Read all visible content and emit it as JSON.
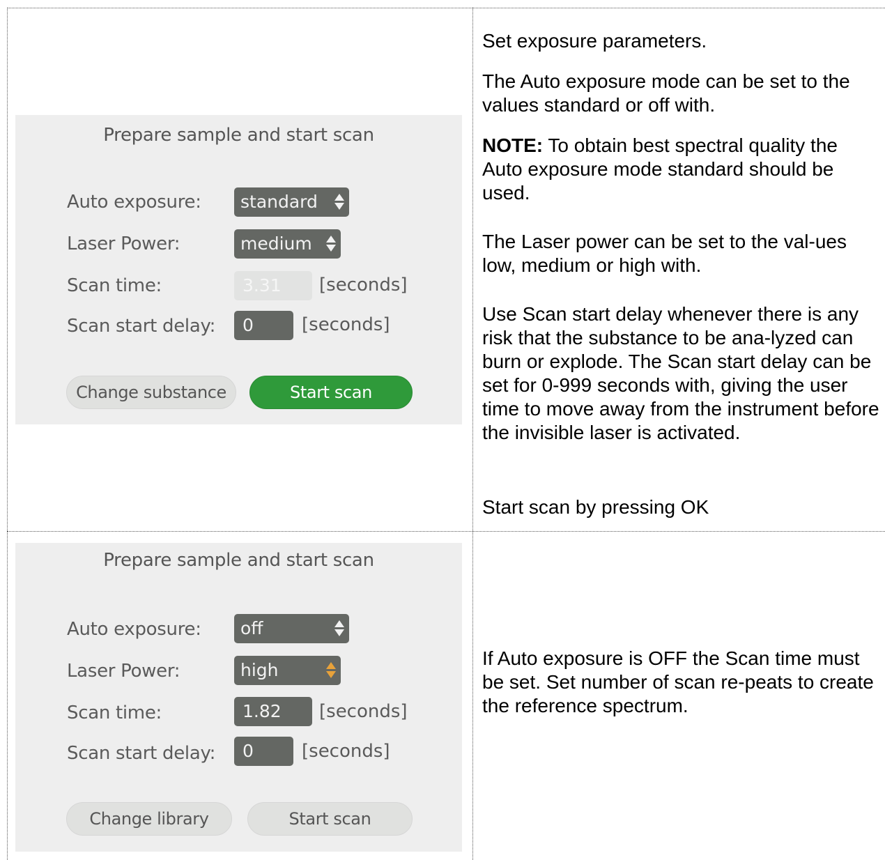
{
  "panel_top": {
    "title": "Prepare sample and start scan",
    "auto_exposure_label": "Auto exposure:",
    "auto_exposure_value": "standard",
    "laser_power_label": "Laser Power:",
    "laser_power_value": "medium",
    "scan_time_label": "Scan time:",
    "scan_time_value": "3.31",
    "scan_time_unit": "[seconds]",
    "scan_delay_label": "Scan start delay:",
    "scan_delay_value": "0",
    "scan_delay_unit": "[seconds]",
    "left_button": "Change substance",
    "right_button": "Start scan",
    "right_button_color": "#2f9a3a"
  },
  "panel_bottom": {
    "title": "Prepare sample and start scan",
    "auto_exposure_label": "Auto exposure:",
    "auto_exposure_value": "off",
    "laser_power_label": "Laser Power:",
    "laser_power_value": "high",
    "laser_power_arrow_color": "#e8a23a",
    "scan_time_label": "Scan time:",
    "scan_time_value": "1.82",
    "scan_time_unit": "[seconds]",
    "scan_delay_label": "Scan start delay:",
    "scan_delay_value": "0",
    "scan_delay_unit": "[seconds]",
    "left_button": "Change library",
    "right_button": "Start scan"
  },
  "text_top": {
    "p1": "Set exposure parameters.",
    "p2": "The Auto exposure mode can be set to the values standard or off with.",
    "note_label": "NOTE:",
    "note_text": " To obtain best spectral quality the Auto exposure mode standard should be used.",
    "p4": "The Laser power can be set to the val-ues low, medium or high with.",
    "p5": "Use Scan start delay whenever there is any risk that the substance to be ana-lyzed can burn or explode. The Scan start delay can be set for 0-999 seconds with, giving the user time to move away from the instrument before the invisible laser is activated.",
    "p6": "Start scan by pressing OK"
  },
  "text_bottom": {
    "p1": "If Auto exposure is OFF the Scan time must be set. Set number of scan re-peats to create the reference spectrum."
  }
}
